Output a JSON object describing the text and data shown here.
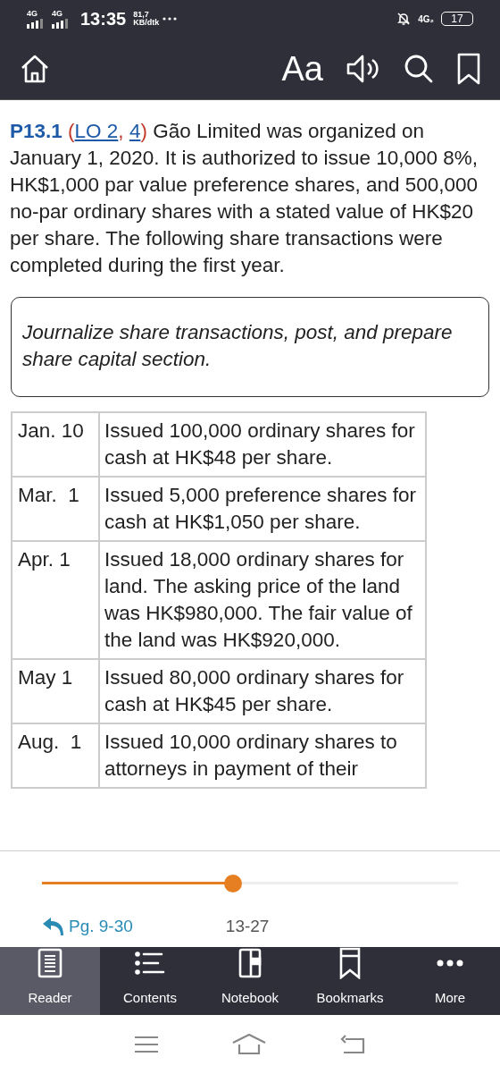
{
  "status_bar": {
    "signals": [
      "4G",
      "4G"
    ],
    "time": "13:35",
    "speed_value": "81,7",
    "speed_unit": "KB/dtk",
    "network": "4G₂",
    "battery": "17"
  },
  "toolbar": {
    "font_button": "Aa"
  },
  "problem": {
    "number": "P13.1",
    "lo_open": "(",
    "links": [
      "LO 2",
      "4"
    ],
    "lo_separator": ", ",
    "lo_close": ")",
    "text": " Gão Limited was organized on January 1, 2020. It is authorized to issue 10,000 8%, HK$1,000 par value preference shares, and 500,000 no-par ordinary shares with a stated value of HK$20 per share. The following share transactions were completed during the first year."
  },
  "task": "Journalize share transactions, post, and prepare share capital section.",
  "transactions": [
    {
      "date": "Jan. 10",
      "text": "Issued 100,000 ordinary shares for cash at HK$48 per share."
    },
    {
      "date": "Mar.  1",
      "text": "Issued 5,000 preference shares for cash at HK$1,050 per share."
    },
    {
      "date": "Apr. 1",
      "text": "Issued 18,000 ordinary shares for land. The asking price of the land was HK$980,000. The fair value of the land was HK$920,000."
    },
    {
      "date": "May 1",
      "text": "Issued 80,000 ordinary shares for cash at HK$45 per share."
    },
    {
      "date": "Aug.  1",
      "text": "Issued 10,000 ordinary shares to attorneys in payment of their"
    }
  ],
  "progress": {
    "level": 0.46,
    "back_link": "Pg. 9-30",
    "page": "13-27"
  },
  "bottom_nav": [
    {
      "label": "Reader",
      "selected": true
    },
    {
      "label": "Contents",
      "selected": false
    },
    {
      "label": "Notebook",
      "selected": false
    },
    {
      "label": "Bookmarks",
      "selected": false
    },
    {
      "label": "More",
      "selected": false
    }
  ]
}
